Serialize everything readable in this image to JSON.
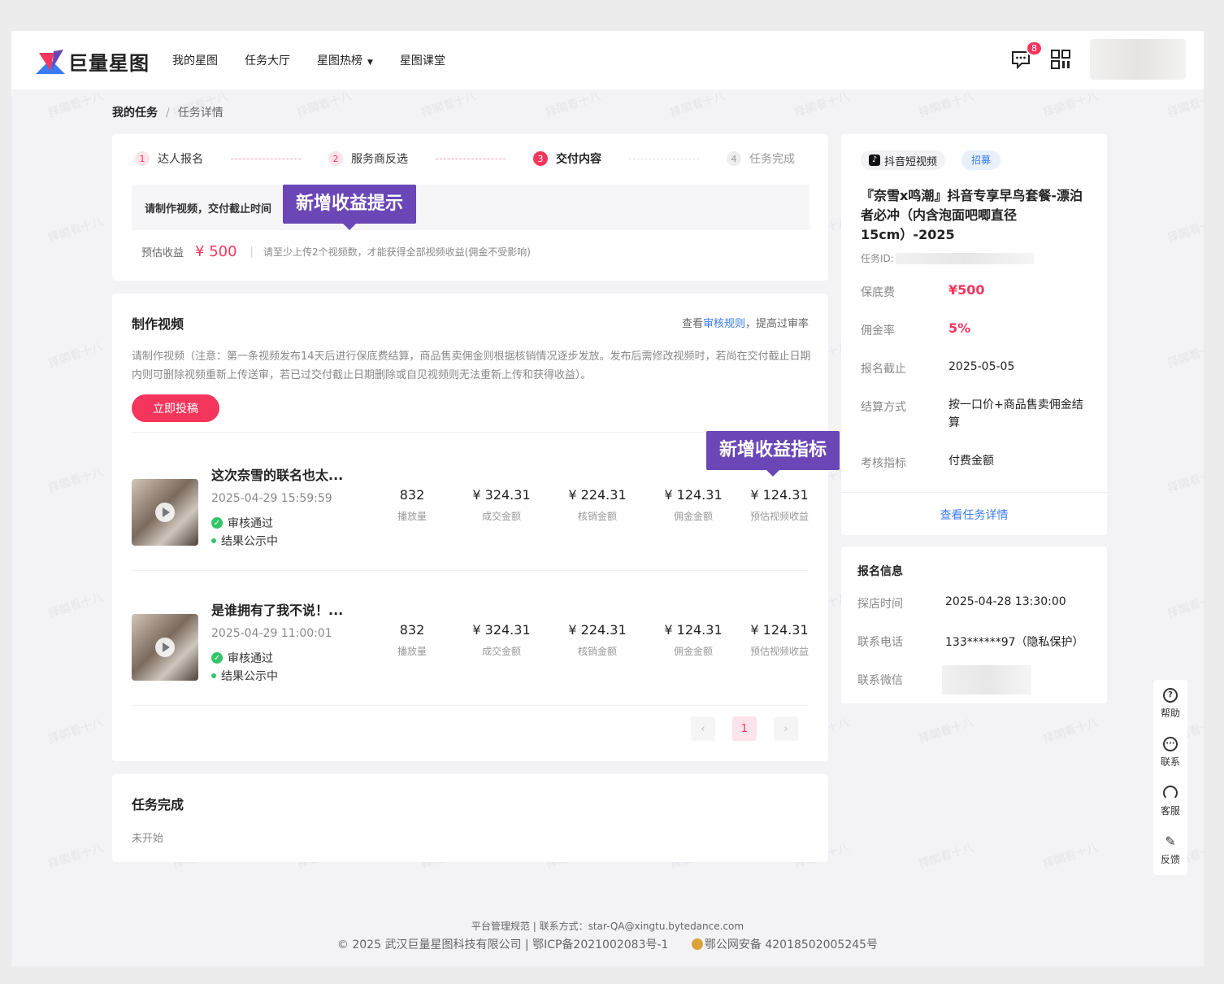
{
  "header": {
    "logo_text": "巨量星图",
    "nav": [
      "我的星图",
      "任务大厅",
      "星图热榜",
      "星图课堂"
    ],
    "nav_dropdown_index": 2,
    "message_badge": "8"
  },
  "breadcrumb": {
    "root": "我的任务",
    "sep": "/",
    "current": "任务详情"
  },
  "steps": [
    {
      "num": "1",
      "label": "达人报名",
      "state": "done"
    },
    {
      "num": "2",
      "label": "服务商反选",
      "state": "done"
    },
    {
      "num": "3",
      "label": "交付内容",
      "state": "current"
    },
    {
      "num": "4",
      "label": "任务完成",
      "state": "todo"
    }
  ],
  "notice": "请制作视频，交付截止时间",
  "tips": {
    "income_tip": "新增收益提示",
    "metric_tip": "新增收益指标"
  },
  "income": {
    "label": "预估收益",
    "amount": "¥ 500",
    "sep": "|",
    "hint": "请至少上传2个视频数，才能获得全部视频收益(佣金不受影响)"
  },
  "make_video": {
    "title": "制作视频",
    "rules_prefix": "查看",
    "rules_link": "审核规则",
    "rules_suffix": "，提高过审率",
    "description": "请制作视频（注意：第一条视频发布14天后进行保底费结算，商品售卖佣金则根据核销情况逐步发放。发布后需修改视频时，若尚在交付截止日期内则可删除视频重新上传送审，若已过交付截止日期删除或自见视频则无法重新上传和获得收益）。",
    "submit_label": "立即投稿",
    "metric_labels": [
      "播放量",
      "成交金额",
      "核销金额",
      "佣金金额",
      "预估视频收益"
    ],
    "videos": [
      {
        "title": "这次奈雪的联名也太...",
        "date": "2025-04-29 15:59:59",
        "status_review": "审核通过",
        "status_result": "结果公示中",
        "metrics": [
          "832",
          "¥ 324.31",
          "¥ 224.31",
          "¥ 124.31",
          "¥ 124.31"
        ]
      },
      {
        "title": "是谁拥有了我不说！...",
        "date": "2025-04-29 11:00:01",
        "status_review": "审核通过",
        "status_result": "结果公示中",
        "metrics": [
          "832",
          "¥ 324.31",
          "¥ 224.31",
          "¥ 124.31",
          "¥ 124.31"
        ]
      }
    ],
    "pager": {
      "prev": "‹",
      "current": "1",
      "next": "›"
    }
  },
  "task_complete": {
    "title": "任务完成",
    "status": "未开始"
  },
  "task_info": {
    "platform": "抖音短视频",
    "tag": "招募",
    "title": "『奈雪x鸣潮』抖音专享早鸟套餐-漂泊者必冲（内含泡面吧唧直径15cm）-2025",
    "id_label": "任务ID:",
    "fields": [
      {
        "label": "保底费",
        "value": "¥500",
        "highlight": true
      },
      {
        "label": "佣金率",
        "value": "5%",
        "highlight": true
      },
      {
        "label": "报名截止",
        "value": "2025-05-05",
        "highlight": false
      },
      {
        "label": "结算方式",
        "value": "按一口价+商品售卖佣金结算",
        "highlight": false
      },
      {
        "label": "考核指标",
        "value": "付费金额",
        "highlight": false
      }
    ],
    "detail_link": "查看任务详情"
  },
  "signup_info": {
    "title": "报名信息",
    "fields": [
      {
        "label": "探店时间",
        "value": "2025-04-28 13:30:00"
      },
      {
        "label": "联系电话",
        "value": "133******97（隐私保护）"
      },
      {
        "label": "联系微信",
        "value": ""
      }
    ]
  },
  "float_bar": [
    {
      "label": "帮助",
      "icon": "help-icon"
    },
    {
      "label": "联系",
      "icon": "chat-icon"
    },
    {
      "label": "客服",
      "icon": "headset-icon"
    },
    {
      "label": "反馈",
      "icon": "edit-icon"
    }
  ],
  "footer": {
    "line1": "平台管理规范 | 联系方式：star-QA@xingtu.bytedance.com",
    "line2": "© 2025 武汉巨量星图科技有限公司 | 鄂ICP备2021002083号-1",
    "line2_police": "鄂公网安备 42018502005245号"
  },
  "watermark_text": "择閣看十八",
  "colors": {
    "accent": "#f5365c",
    "link": "#3b7cf5",
    "tip": "#6a46b6",
    "success": "#34c46a"
  }
}
